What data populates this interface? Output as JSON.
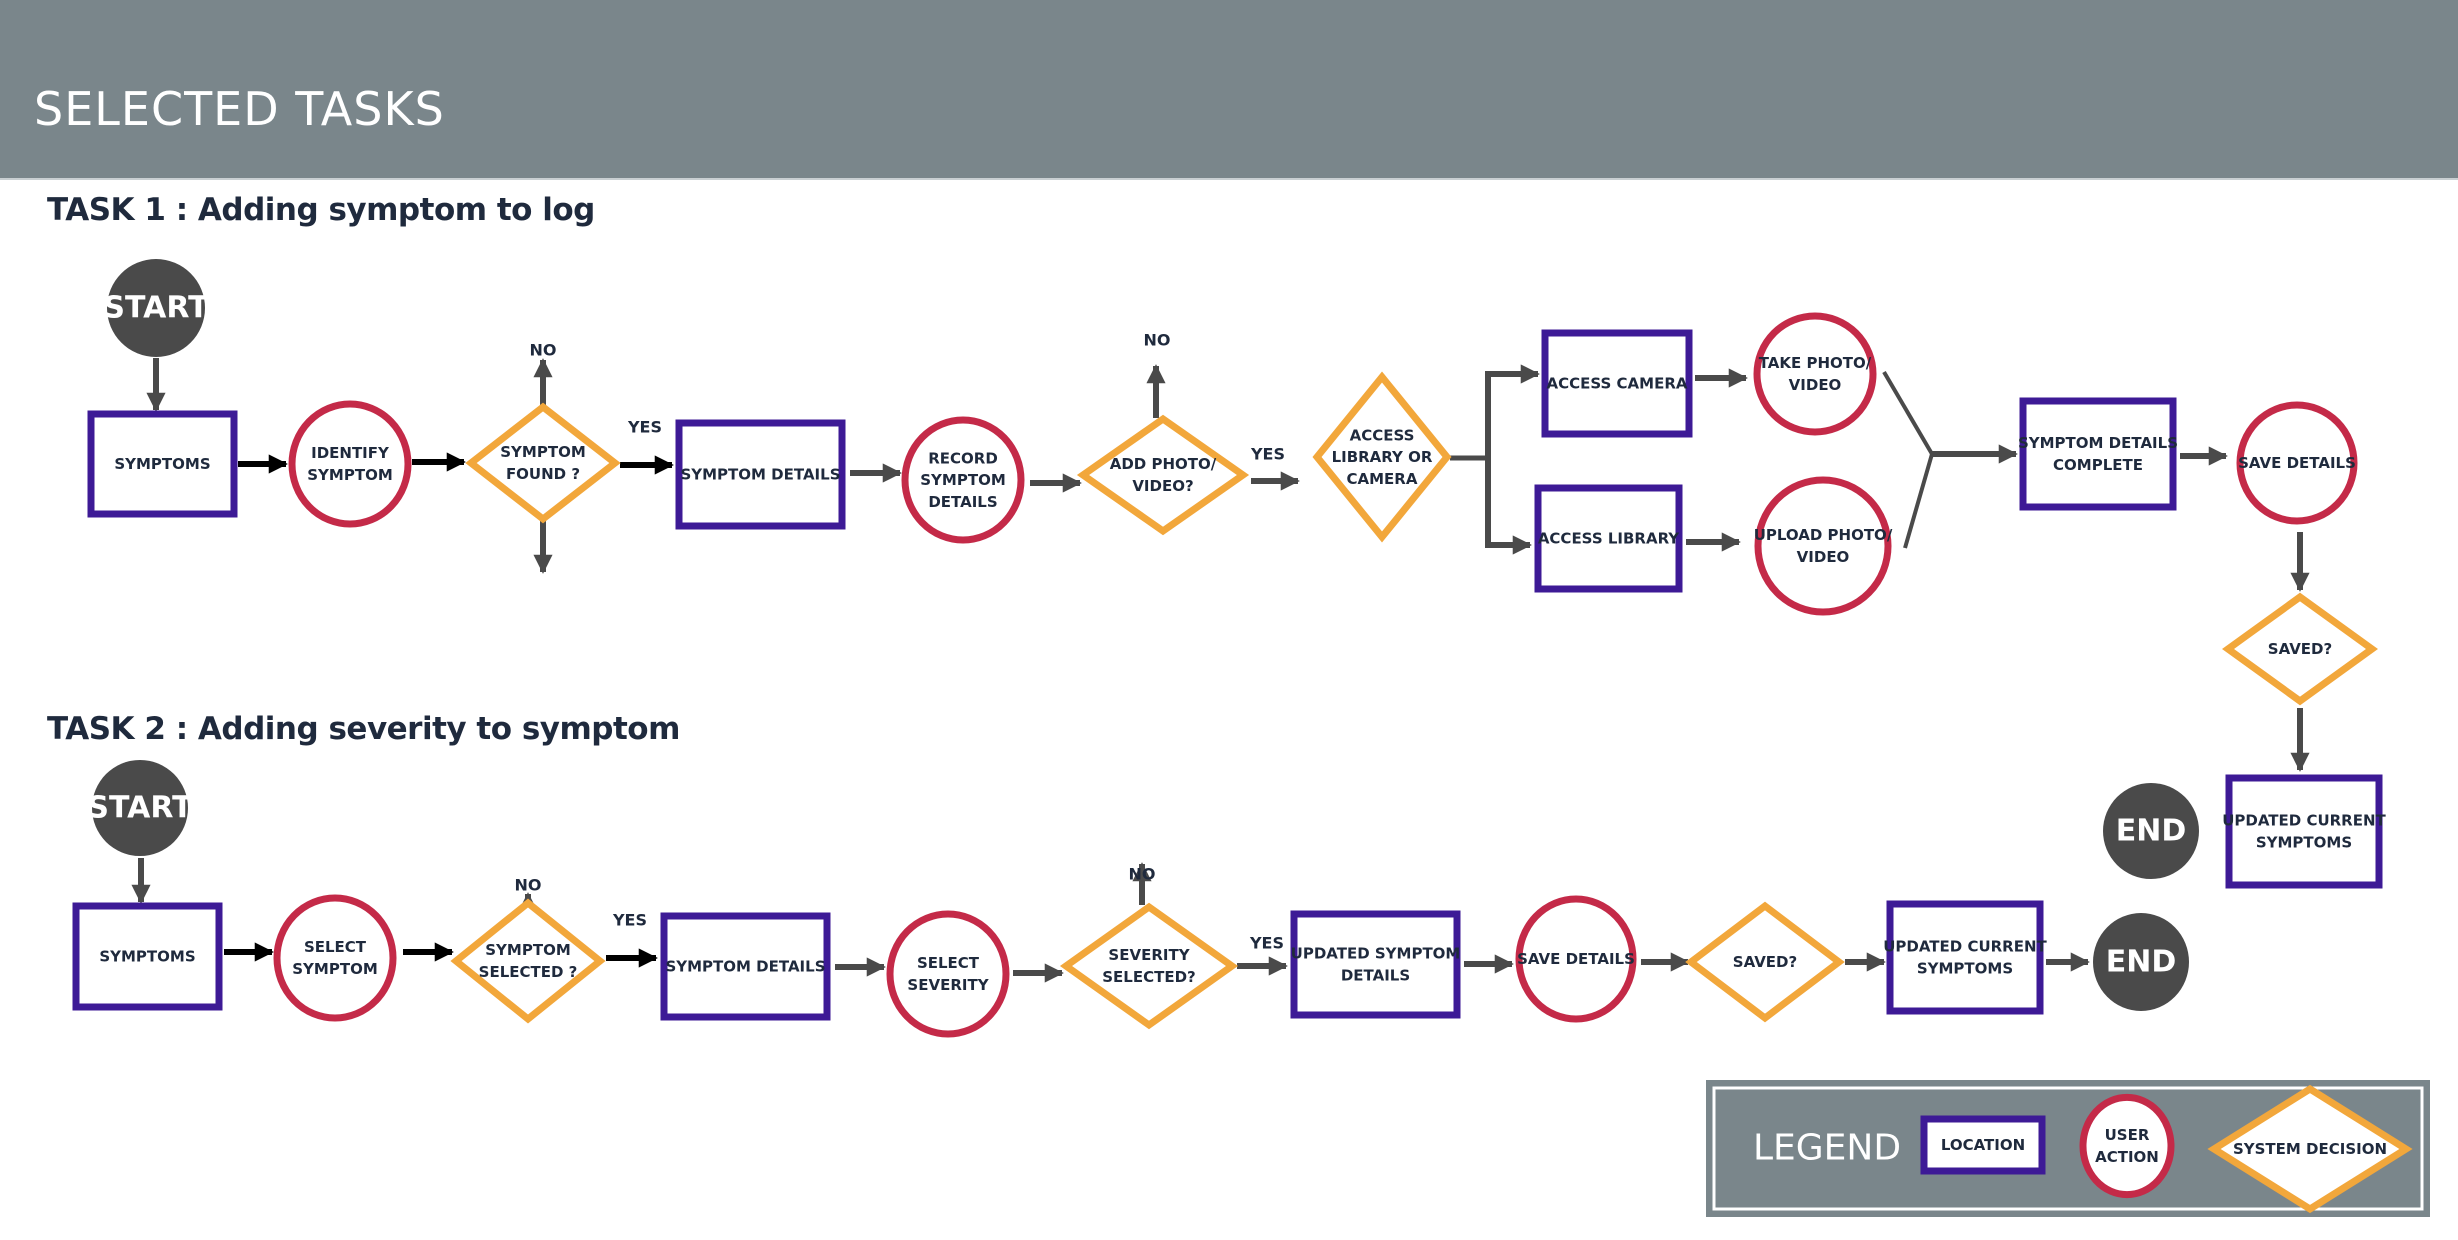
{
  "header": {
    "title": "SELECTED TASKS"
  },
  "colors": {
    "header_bg": "#7a868b",
    "location": "#3d1a96",
    "user_action": "#c42a48",
    "system_decision": "#f2a73b",
    "terminal": "#4a4a4a",
    "connector": "#4a4a4a",
    "text": "#1f2a3d"
  },
  "tasks": [
    {
      "title": "TASK 1 : Adding symptom to log",
      "nodes": [
        {
          "id": "t1-start",
          "type": "terminal",
          "label": [
            "START"
          ]
        },
        {
          "id": "t1-symptoms",
          "type": "location",
          "label": [
            "SYMPTOMS"
          ]
        },
        {
          "id": "t1-identify-symptom",
          "type": "user_action",
          "label": [
            "IDENTIFY",
            "SYMPTOM"
          ]
        },
        {
          "id": "t1-symptom-found",
          "type": "system_decision",
          "label": [
            "SYMPTOM",
            "FOUND ?"
          ]
        },
        {
          "id": "t1-symptom-details",
          "type": "location",
          "label": [
            "SYMPTOM DETAILS"
          ]
        },
        {
          "id": "t1-record-symptom-details",
          "type": "user_action",
          "label": [
            "RECORD",
            "SYMPTOM",
            "DETAILS"
          ]
        },
        {
          "id": "t1-add-photo-video",
          "type": "system_decision",
          "label": [
            "ADD PHOTO/",
            "VIDEO?"
          ]
        },
        {
          "id": "t1-access-library-or-camera",
          "type": "system_decision",
          "label": [
            "ACCESS",
            "LIBRARY OR",
            "CAMERA"
          ]
        },
        {
          "id": "t1-access-camera",
          "type": "location",
          "label": [
            "ACCESS CAMERA"
          ]
        },
        {
          "id": "t1-take-photo-video",
          "type": "user_action",
          "label": [
            "TAKE PHOTO/",
            "VIDEO"
          ]
        },
        {
          "id": "t1-access-library",
          "type": "location",
          "label": [
            "ACCESS LIBRARY"
          ]
        },
        {
          "id": "t1-upload-photo-video",
          "type": "user_action",
          "label": [
            "UPLOAD PHOTO/",
            "VIDEO"
          ]
        },
        {
          "id": "t1-symptom-details-complete",
          "type": "location",
          "label": [
            "SYMPTOM DETAILS",
            "COMPLETE"
          ]
        },
        {
          "id": "t1-save-details",
          "type": "user_action",
          "label": [
            "SAVE DETAILS"
          ]
        },
        {
          "id": "t1-saved",
          "type": "system_decision",
          "label": [
            "SAVED?"
          ]
        },
        {
          "id": "t1-updated-current-symptoms",
          "type": "location",
          "label": [
            "UPDATED CURRENT",
            "SYMPTOMS"
          ]
        },
        {
          "id": "t1-end",
          "type": "terminal",
          "label": [
            "END"
          ]
        }
      ],
      "edge_labels": [
        {
          "id": "t1-found-no",
          "text": "NO"
        },
        {
          "id": "t1-found-yes",
          "text": "YES"
        },
        {
          "id": "t1-photo-no",
          "text": "NO"
        },
        {
          "id": "t1-photo-yes",
          "text": "YES"
        }
      ]
    },
    {
      "title": "TASK 2 : Adding severity to symptom",
      "nodes": [
        {
          "id": "t2-start",
          "type": "terminal",
          "label": [
            "START"
          ]
        },
        {
          "id": "t2-symptoms",
          "type": "location",
          "label": [
            "SYMPTOMS"
          ]
        },
        {
          "id": "t2-select-symptom",
          "type": "user_action",
          "label": [
            "SELECT",
            "SYMPTOM"
          ]
        },
        {
          "id": "t2-symptom-selected",
          "type": "system_decision",
          "label": [
            "SYMPTOM",
            "SELECTED ?"
          ]
        },
        {
          "id": "t2-symptom-details",
          "type": "location",
          "label": [
            "SYMPTOM DETAILS"
          ]
        },
        {
          "id": "t2-select-severity",
          "type": "user_action",
          "label": [
            "SELECT",
            "SEVERITY"
          ]
        },
        {
          "id": "t2-severity-selected",
          "type": "system_decision",
          "label": [
            "SEVERITY",
            "SELECTED?"
          ]
        },
        {
          "id": "t2-updated-symptom-details",
          "type": "location",
          "label": [
            "UPDATED SYMPTOM",
            "DETAILS"
          ]
        },
        {
          "id": "t2-save-details",
          "type": "user_action",
          "label": [
            "SAVE DETAILS"
          ]
        },
        {
          "id": "t2-saved",
          "type": "system_decision",
          "label": [
            "SAVED?"
          ]
        },
        {
          "id": "t2-updated-current-symptoms",
          "type": "location",
          "label": [
            "UPDATED CURRENT",
            "SYMPTOMS"
          ]
        },
        {
          "id": "t2-end",
          "type": "terminal",
          "label": [
            "END"
          ]
        }
      ],
      "edge_labels": [
        {
          "id": "t2-selected-no",
          "text": "NO"
        },
        {
          "id": "t2-selected-yes",
          "text": "YES"
        },
        {
          "id": "t2-severity-no",
          "text": "NO"
        },
        {
          "id": "t2-severity-yes",
          "text": "YES"
        }
      ]
    }
  ],
  "legend": {
    "title": "LEGEND",
    "items": [
      {
        "type": "location",
        "label": [
          "LOCATION"
        ]
      },
      {
        "type": "user_action",
        "label": [
          "USER",
          "ACTION"
        ]
      },
      {
        "type": "system_decision",
        "label": [
          "SYSTEM DECISION"
        ]
      }
    ]
  }
}
